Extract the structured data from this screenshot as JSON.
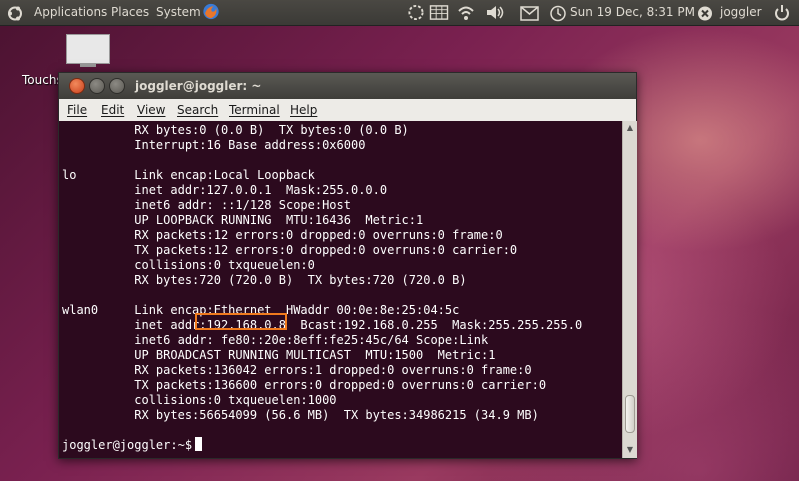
{
  "panel": {
    "applications_label": "Applications",
    "places_label": "Places",
    "system_label": "System",
    "datetime": "Sun 19 Dec,  8:31 PM",
    "user": "joggler"
  },
  "desktop": {
    "icon_label": "Touchs"
  },
  "window": {
    "title": "joggler@joggler: ~",
    "menu": [
      "File",
      "Edit",
      "View",
      "Search",
      "Terminal",
      "Help"
    ]
  },
  "terminal": {
    "lines": [
      "          RX bytes:0 (0.0 B)  TX bytes:0 (0.0 B)",
      "          Interrupt:16 Base address:0x6000",
      "",
      "lo        Link encap:Local Loopback",
      "          inet addr:127.0.0.1  Mask:255.0.0.0",
      "          inet6 addr: ::1/128 Scope:Host",
      "          UP LOOPBACK RUNNING  MTU:16436  Metric:1",
      "          RX packets:12 errors:0 dropped:0 overruns:0 frame:0",
      "          TX packets:12 errors:0 dropped:0 overruns:0 carrier:0",
      "          collisions:0 txqueuelen:0",
      "          RX bytes:720 (720.0 B)  TX bytes:720 (720.0 B)",
      "",
      "wlan0     Link encap:Ethernet  HWaddr 00:0e:8e:25:04:5c",
      "          inet addr:192.168.0.8  Bcast:192.168.0.255  Mask:255.255.255.0",
      "          inet6 addr: fe80::20e:8eff:fe25:45c/64 Scope:Link",
      "          UP BROADCAST RUNNING MULTICAST  MTU:1500  Metric:1",
      "          RX packets:136042 errors:1 dropped:0 overruns:0 frame:0",
      "          TX packets:136600 errors:0 dropped:0 overruns:0 carrier:0",
      "          collisions:0 txqueuelen:1000",
      "          RX bytes:56654099 (56.6 MB)  TX bytes:34986215 (34.9 MB)",
      "",
      "joggler@joggler:~$ "
    ]
  },
  "colors": {
    "terminal_bg": "#2c0a1e",
    "highlight": "#f07a1e",
    "close_button": "#e25b2f"
  }
}
